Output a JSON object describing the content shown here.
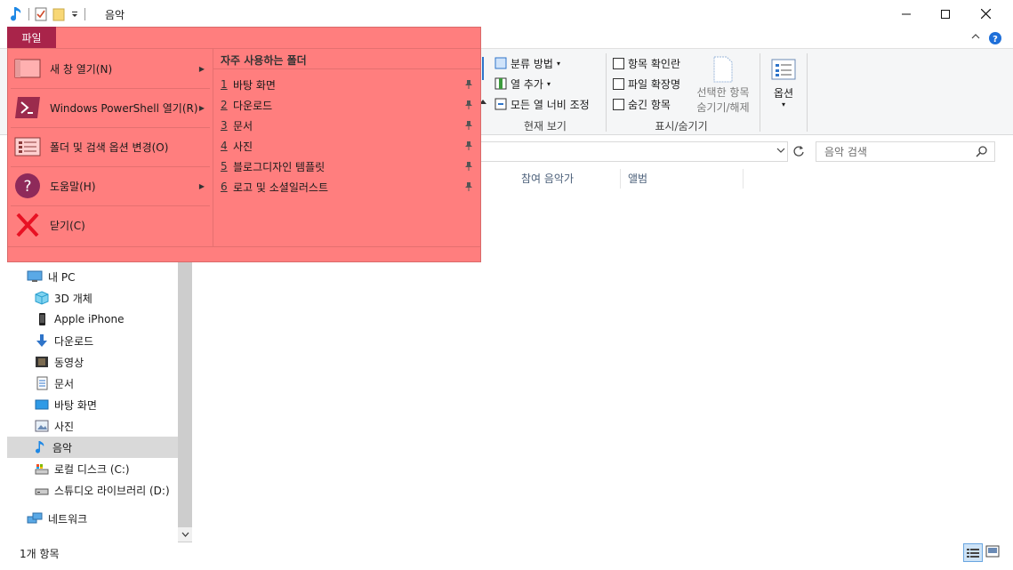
{
  "window": {
    "title": "음악",
    "minimize_glyph": "—",
    "maximize_glyph": "☐",
    "close_glyph": "✕"
  },
  "file_menu": {
    "tab_label": "파일",
    "items": [
      {
        "label": "새 창 열기(N)",
        "icon": "new-window-icon",
        "has_submenu": true
      },
      {
        "label": "Windows PowerShell 열기(R)",
        "icon": "powershell-icon",
        "has_submenu": true
      },
      {
        "label": "폴더 및 검색 옵션 변경(O)",
        "icon": "folder-options-icon",
        "has_submenu": false
      },
      {
        "label": "도움말(H)",
        "icon": "help-icon",
        "has_submenu": true
      },
      {
        "label": "닫기(C)",
        "icon": "close-x-icon",
        "has_submenu": false
      }
    ],
    "frequent_title": "자주 사용하는 폴더",
    "frequent_folders": [
      {
        "num": "1",
        "label": "바탕 화면"
      },
      {
        "num": "2",
        "label": "다운로드"
      },
      {
        "num": "3",
        "label": "문서"
      },
      {
        "num": "4",
        "label": "사진"
      },
      {
        "num": "5",
        "label": "블로그디자인 템플릿"
      },
      {
        "num": "6",
        "label": "로고 및 소셜일러스트"
      }
    ]
  },
  "ribbon": {
    "current_view": {
      "sort_label": "분류 방법",
      "add_column_label": "열 추가",
      "fit_columns_label": "모든 열 너비 조정",
      "group_label": "현재 보기"
    },
    "show_hide": {
      "item_checkboxes_label": "항목 확인란",
      "file_extensions_label": "파일 확장명",
      "hidden_items_label": "숨긴 항목",
      "hide_selected_line1": "선택한 항목",
      "hide_selected_line2": "숨기기/해제",
      "group_label": "표시/숨기기"
    },
    "options_label": "옵션"
  },
  "search": {
    "placeholder": "음악 검색"
  },
  "columns": [
    {
      "label": "참여 음악가"
    },
    {
      "label": "앨범"
    }
  ],
  "nav": {
    "items": [
      {
        "label": "내 PC",
        "icon": "this-pc-icon",
        "level": 0
      },
      {
        "label": "3D 개체",
        "icon": "3d-objects-icon",
        "level": 1
      },
      {
        "label": "Apple iPhone",
        "icon": "iphone-icon",
        "level": 1
      },
      {
        "label": "다운로드",
        "icon": "download-icon",
        "level": 1
      },
      {
        "label": "동영상",
        "icon": "video-icon",
        "level": 1
      },
      {
        "label": "문서",
        "icon": "document-icon",
        "level": 1
      },
      {
        "label": "바탕 화면",
        "icon": "desktop-icon",
        "level": 1
      },
      {
        "label": "사진",
        "icon": "pictures-icon",
        "level": 1
      },
      {
        "label": "음악",
        "icon": "music-icon",
        "level": 1,
        "selected": true
      },
      {
        "label": "로컬 디스크 (C:)",
        "icon": "local-disk-icon",
        "level": 1
      },
      {
        "label": "스튜디오 라이브러리 (D:)",
        "icon": "drive-icon",
        "level": 1
      },
      {
        "label": "네트워크",
        "icon": "network-icon",
        "level": 0
      }
    ]
  },
  "status": {
    "item_count": "1개 항목"
  },
  "colors": {
    "file_menu_bg": "#ff7e7e",
    "file_tab_bg": "#a9244a",
    "selection_bg": "#d9d9d9",
    "accent_blue": "#1e88e5"
  }
}
